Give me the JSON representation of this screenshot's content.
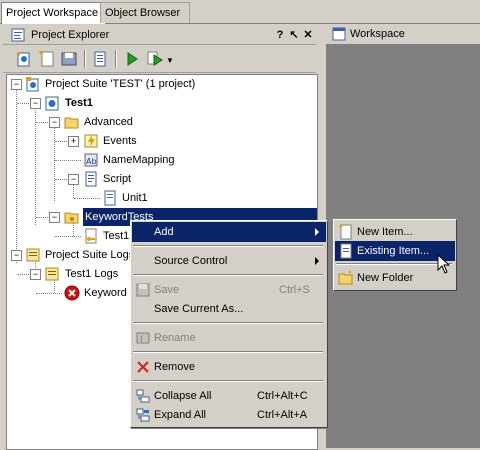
{
  "tabs": {
    "active": "Project Workspace",
    "inactive": "Object Browser"
  },
  "explorer": {
    "title": "Project Explorer",
    "btn_help": "?",
    "btn_pin": "↖",
    "btn_close": "✕"
  },
  "workspace": {
    "title": "Workspace"
  },
  "tree": {
    "suite": "Project Suite 'TEST' (1 project)",
    "project": "Test1",
    "advanced": "Advanced",
    "events": "Events",
    "namemapping": "NameMapping",
    "script": "Script",
    "unit1": "Unit1",
    "keywordtests": "KeywordTests",
    "test1": "Test1",
    "suite_logs": "Project Suite Logs",
    "test1_logs": "Test1 Logs",
    "keyword": "Keyword"
  },
  "context_menu": {
    "add": "Add",
    "source_control": "Source Control",
    "save": "Save",
    "save_shortcut": "Ctrl+S",
    "save_current_as": "Save Current As...",
    "rename": "Rename",
    "remove": "Remove",
    "collapse_all": "Collapse All",
    "collapse_shortcut": "Ctrl+Alt+C",
    "expand_all": "Expand All",
    "expand_shortcut": "Ctrl+Alt+A"
  },
  "submenu": {
    "new_item": "New Item...",
    "existing_item": "Existing Item...",
    "new_folder": "New Folder"
  }
}
